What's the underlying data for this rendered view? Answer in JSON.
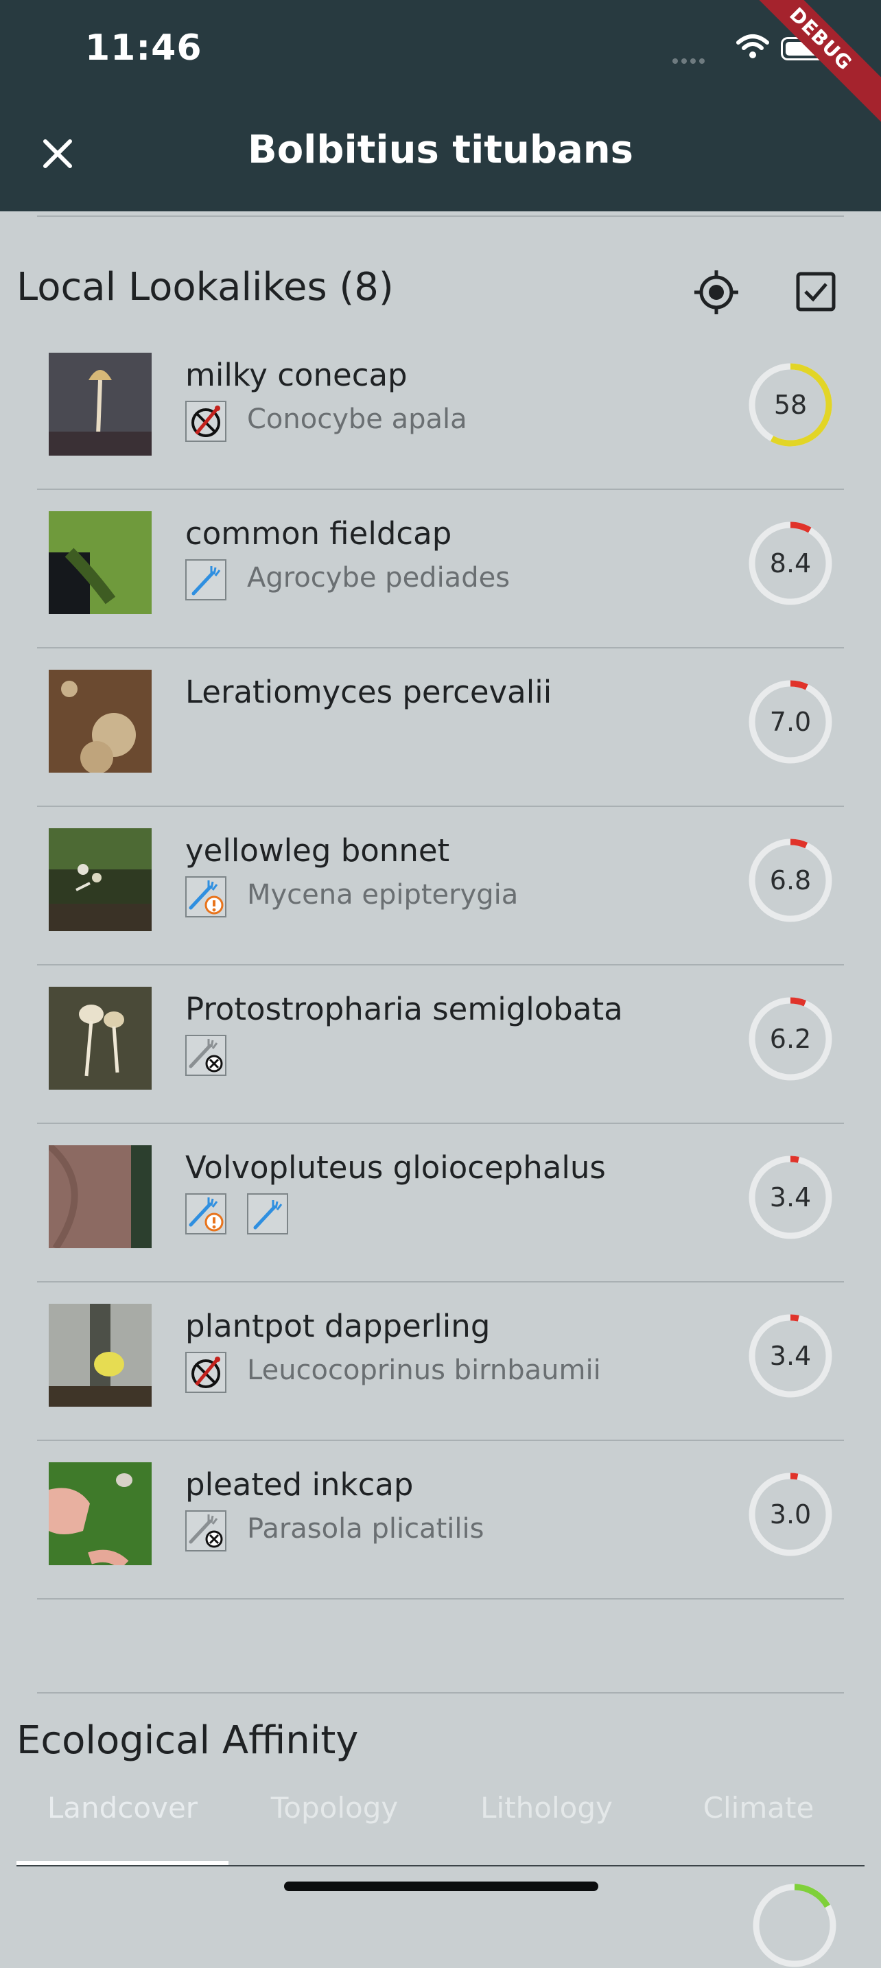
{
  "status_bar": {
    "time": "11:46",
    "debug_label": "DEBUG"
  },
  "app_bar": {
    "title": "Bolbitius titubans",
    "close_icon": "close-icon"
  },
  "colors": {
    "appbar": "#283a40",
    "background": "#c9cfd1",
    "ring_track": "#e9ebec",
    "ring_low": "#e0332a",
    "ring_high": "#e2d526",
    "edible_blue": "#2f8fe0",
    "warning_orange": "#e8741c"
  },
  "lookalikes": {
    "heading": "Local Lookalikes (8)",
    "locate_icon": "my-location-icon",
    "select_icon": "checkbox-icon",
    "items": [
      {
        "name": "milky conecap",
        "scientific": "Conocybe apala",
        "score": "58",
        "score_value": 58,
        "badges": [
          "poisonous-icon"
        ],
        "thumb": "mushroom-dark"
      },
      {
        "name": "common fieldcap",
        "scientific": "Agrocybe pediades",
        "score": "8.4",
        "score_value": 8.4,
        "badges": [
          "edible-icon"
        ],
        "thumb": "grass"
      },
      {
        "name": "Leratiomyces percevalii",
        "scientific": "",
        "score": "7.0",
        "score_value": 7.0,
        "badges": [],
        "thumb": "mulch"
      },
      {
        "name": "yellowleg bonnet",
        "scientific": "Mycena epipterygia",
        "score": "6.8",
        "score_value": 6.8,
        "badges": [
          "edible-caution-icon"
        ],
        "thumb": "forest"
      },
      {
        "name": "Protostropharia semiglobata",
        "scientific": "",
        "score": "6.2",
        "score_value": 6.2,
        "badges": [
          "inedible-icon"
        ],
        "thumb": "dung"
      },
      {
        "name": "Volvopluteus gloiocephalus",
        "scientific": "",
        "score": "3.4",
        "score_value": 3.4,
        "badges": [
          "edible-caution-icon",
          "edible-icon"
        ],
        "thumb": "cap-closeup"
      },
      {
        "name": "plantpot dapperling",
        "scientific": "Leucocoprinus birnbaumii",
        "score": "3.4",
        "score_value": 3.4,
        "badges": [
          "poisonous-icon"
        ],
        "thumb": "pot"
      },
      {
        "name": "pleated inkcap",
        "scientific": "Parasola plicatilis",
        "score": "3.0",
        "score_value": 3.0,
        "badges": [
          "inedible-icon"
        ],
        "thumb": "hand-grass"
      }
    ]
  },
  "ecology": {
    "heading": "Ecological Affinity",
    "tabs": [
      {
        "label": "Landcover",
        "selected": true
      },
      {
        "label": "Topology",
        "selected": false
      },
      {
        "label": "Lithology",
        "selected": false
      },
      {
        "label": "Climate",
        "selected": false
      }
    ]
  }
}
